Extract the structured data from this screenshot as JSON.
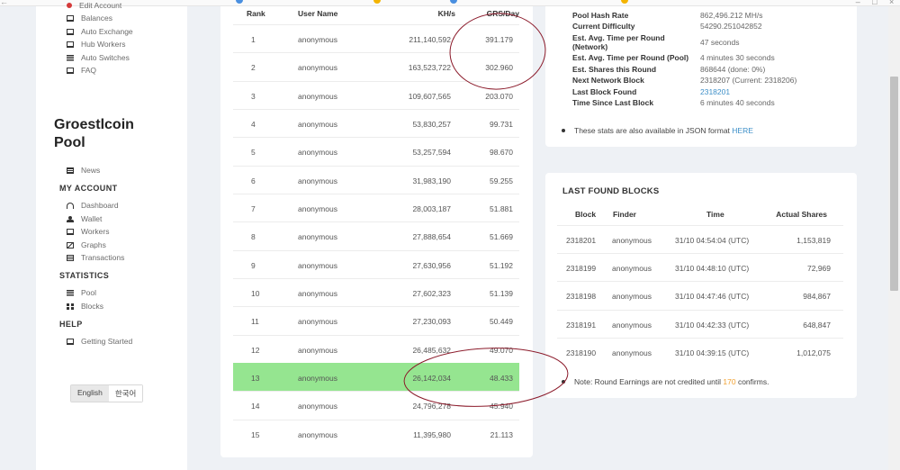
{
  "sidebar": {
    "nav_top": [
      {
        "label": "Edit Account",
        "icon": "user-icon"
      },
      {
        "label": "Balances",
        "icon": "monitor-icon"
      },
      {
        "label": "Auto Exchange",
        "icon": "monitor-icon"
      },
      {
        "label": "Hub Workers",
        "icon": "monitor-icon"
      },
      {
        "label": "Auto Switches",
        "icon": "list-icon"
      },
      {
        "label": "FAQ",
        "icon": "monitor-icon"
      }
    ],
    "pool_title_line1": "Groestlcoin",
    "pool_title_line2": "Pool",
    "news": "News",
    "my_account_header": "MY ACCOUNT",
    "my_account": [
      "Dashboard",
      "Wallet",
      "Workers",
      "Graphs",
      "Transactions"
    ],
    "statistics_header": "STATISTICS",
    "statistics": [
      "Pool",
      "Blocks"
    ],
    "help_header": "HELP",
    "help": [
      "Getting Started"
    ],
    "lang_english": "English",
    "lang_korean": "한국어"
  },
  "rank_table": {
    "headers": {
      "rank": "Rank",
      "user": "User Name",
      "khs": "KH/s",
      "grs": "GRS/Day"
    },
    "rows": [
      {
        "rank": "1",
        "user": "anonymous",
        "khs": "211,140,592",
        "grs": "391.179"
      },
      {
        "rank": "2",
        "user": "anonymous",
        "khs": "163,523,722",
        "grs": "302.960"
      },
      {
        "rank": "3",
        "user": "anonymous",
        "khs": "109,607,565",
        "grs": "203.070"
      },
      {
        "rank": "4",
        "user": "anonymous",
        "khs": "53,830,257",
        "grs": "99.731"
      },
      {
        "rank": "5",
        "user": "anonymous",
        "khs": "53,257,594",
        "grs": "98.670"
      },
      {
        "rank": "6",
        "user": "anonymous",
        "khs": "31,983,190",
        "grs": "59.255"
      },
      {
        "rank": "7",
        "user": "anonymous",
        "khs": "28,003,187",
        "grs": "51.881"
      },
      {
        "rank": "8",
        "user": "anonymous",
        "khs": "27,888,654",
        "grs": "51.669"
      },
      {
        "rank": "9",
        "user": "anonymous",
        "khs": "27,630,956",
        "grs": "51.192"
      },
      {
        "rank": "10",
        "user": "anonymous",
        "khs": "27,602,323",
        "grs": "51.139"
      },
      {
        "rank": "11",
        "user": "anonymous",
        "khs": "27,230,093",
        "grs": "50.449"
      },
      {
        "rank": "12",
        "user": "anonymous",
        "khs": "26,485,632",
        "grs": "49.070"
      },
      {
        "rank": "13",
        "user": "anonymous",
        "khs": "26,142,034",
        "grs": "48.433"
      },
      {
        "rank": "14",
        "user": "anonymous",
        "khs": "24,796,278",
        "grs": "45.940"
      },
      {
        "rank": "15",
        "user": "anonymous",
        "khs": "11,395,980",
        "grs": "21.113"
      }
    ],
    "highlight_color": "#95e590"
  },
  "pool_stats": {
    "rows": [
      {
        "label": "Pool Hash Rate",
        "value": "862,496.212 MH/s"
      },
      {
        "label": "Current Difficulty",
        "value": "54290.251042852"
      },
      {
        "label": "Est. Avg. Time per Round (Network)",
        "value": "47 seconds"
      },
      {
        "label": "Est. Avg. Time per Round (Pool)",
        "value": "4 minutes 30 seconds"
      },
      {
        "label": "Est. Shares this Round",
        "value": "868644 (done: 0%)"
      },
      {
        "label": "Next Network Block",
        "value": "2318207 (Current: 2318206)"
      },
      {
        "label": "Last Block Found",
        "value": "2318201"
      },
      {
        "label": "Time Since Last Block",
        "value": "6 minutes 40 seconds"
      }
    ],
    "json_note": "These stats are also available in JSON format",
    "json_link": "HERE"
  },
  "last_blocks": {
    "title": "LAST FOUND BLOCKS",
    "headers": {
      "block": "Block",
      "finder": "Finder",
      "time": "Time",
      "shares": "Actual Shares"
    },
    "rows": [
      {
        "block": "2318201",
        "finder": "anonymous",
        "time": "31/10 04:54:04 (UTC)",
        "shares": "1,153,819"
      },
      {
        "block": "2318199",
        "finder": "anonymous",
        "time": "31/10 04:48:10 (UTC)",
        "shares": "72,969"
      },
      {
        "block": "2318198",
        "finder": "anonymous",
        "time": "31/10 04:47:46 (UTC)",
        "shares": "984,867"
      },
      {
        "block": "2318191",
        "finder": "anonymous",
        "time": "31/10 04:42:33 (UTC)",
        "shares": "648,847"
      },
      {
        "block": "2318190",
        "finder": "anonymous",
        "time": "31/10 04:39:15 (UTC)",
        "shares": "1,012,075"
      }
    ],
    "note_prefix": "Note: Round Earnings are not credited until",
    "note_confirms": "170",
    "note_suffix": "confirms."
  },
  "colors": {
    "link": "#3d8fc8",
    "accent_orange": "#f0a030",
    "annotation": "#8b1a2a"
  }
}
